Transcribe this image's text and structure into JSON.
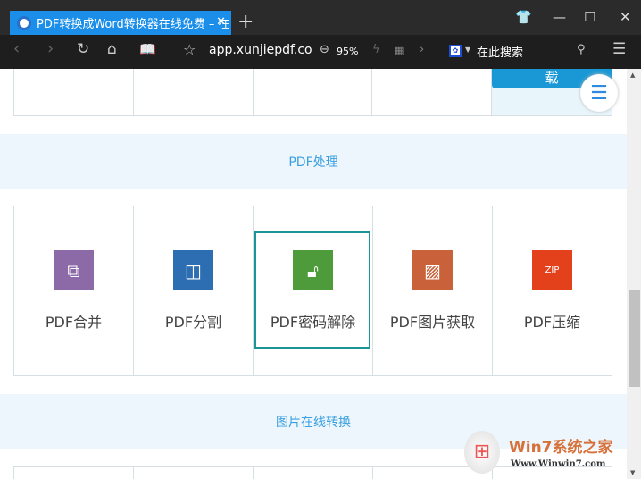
{
  "browser": {
    "tab_title": "PDF转换成Word转换器在线免费 – 在",
    "url": "app.xunjiepdf.co",
    "zoom": "95%",
    "search_placeholder": "在此搜索"
  },
  "top_row": {
    "download_fragment": "载"
  },
  "sections": [
    {
      "title": "PDF处理"
    },
    {
      "title": "图片在线转换"
    }
  ],
  "tools": [
    {
      "label": "PDF合并",
      "color": "#8c6aa7",
      "icon": "merge-icon"
    },
    {
      "label": "PDF分割",
      "color": "#2d6db2",
      "icon": "split-icon"
    },
    {
      "label": "PDF密码解除",
      "color": "#4e9b3b",
      "icon": "unlock-icon"
    },
    {
      "label": "PDF图片获取",
      "color": "#c9623b",
      "icon": "image-icon"
    },
    {
      "label": "PDF压缩",
      "color": "#e2411b",
      "icon": "zip-icon"
    }
  ],
  "watermark": {
    "brand": "Win7系统之家",
    "url": "Www.Winwin7.com"
  }
}
